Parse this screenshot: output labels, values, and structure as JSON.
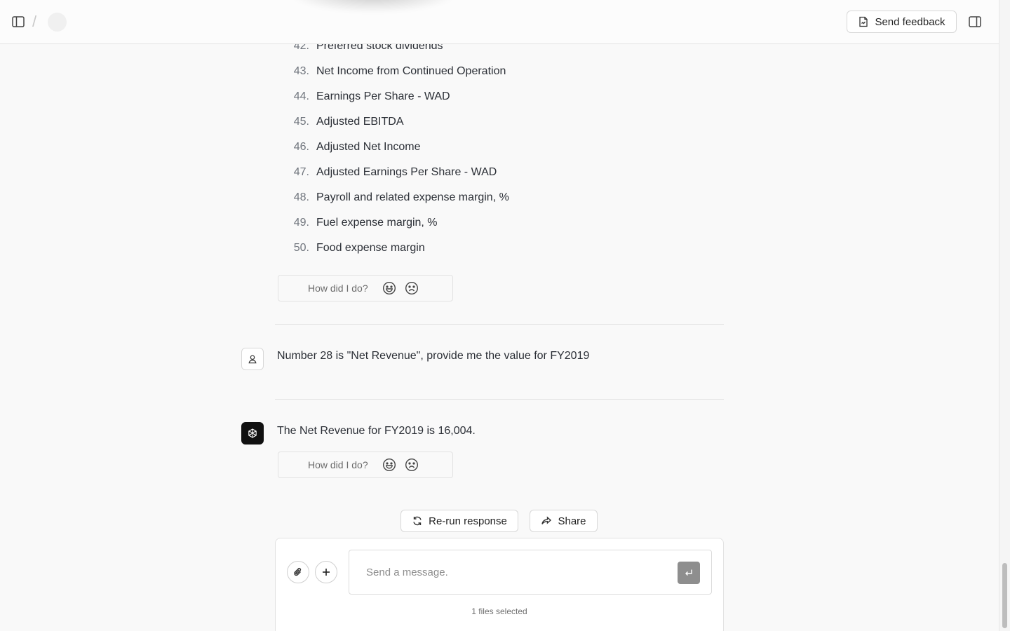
{
  "header": {
    "separator": "/",
    "feedback_label": "Send feedback"
  },
  "list_items": [
    {
      "num": "42.",
      "text": "Preferred stock dividends"
    },
    {
      "num": "43.",
      "text": "Net Income from Continued Operation"
    },
    {
      "num": "44.",
      "text": "Earnings Per Share - WAD"
    },
    {
      "num": "45.",
      "text": "Adjusted EBITDA"
    },
    {
      "num": "46.",
      "text": "Adjusted Net Income"
    },
    {
      "num": "47.",
      "text": "Adjusted Earnings Per Share - WAD"
    },
    {
      "num": "48.",
      "text": "Payroll and related expense margin, %"
    },
    {
      "num": "49.",
      "text": "Fuel expense margin, %"
    },
    {
      "num": "50.",
      "text": "Food expense margin"
    }
  ],
  "rating": {
    "question": "How did I do?"
  },
  "messages": {
    "user": "Number 28 is \"Net Revenue\", provide me the value for FY2019",
    "assistant": "The Net Revenue for FY2019 is 16,004."
  },
  "actions": {
    "rerun_label": "Re-run response",
    "share_label": "Share"
  },
  "composer": {
    "placeholder": "Send a message.",
    "files_note": "1 files selected"
  },
  "icons": {
    "sidebar_toggle": "sidebar-left-icon",
    "feedback": "file-feedback-icon",
    "panel_toggle": "sidebar-right-icon",
    "user": "user-icon",
    "assistant": "openai-logo-icon",
    "happy": "smile-icon",
    "sad": "frown-icon",
    "rerun": "refresh-icon",
    "share": "share-arrow-icon",
    "attach": "paperclip-icon",
    "plus": "plus-icon",
    "send": "enter-icon"
  }
}
